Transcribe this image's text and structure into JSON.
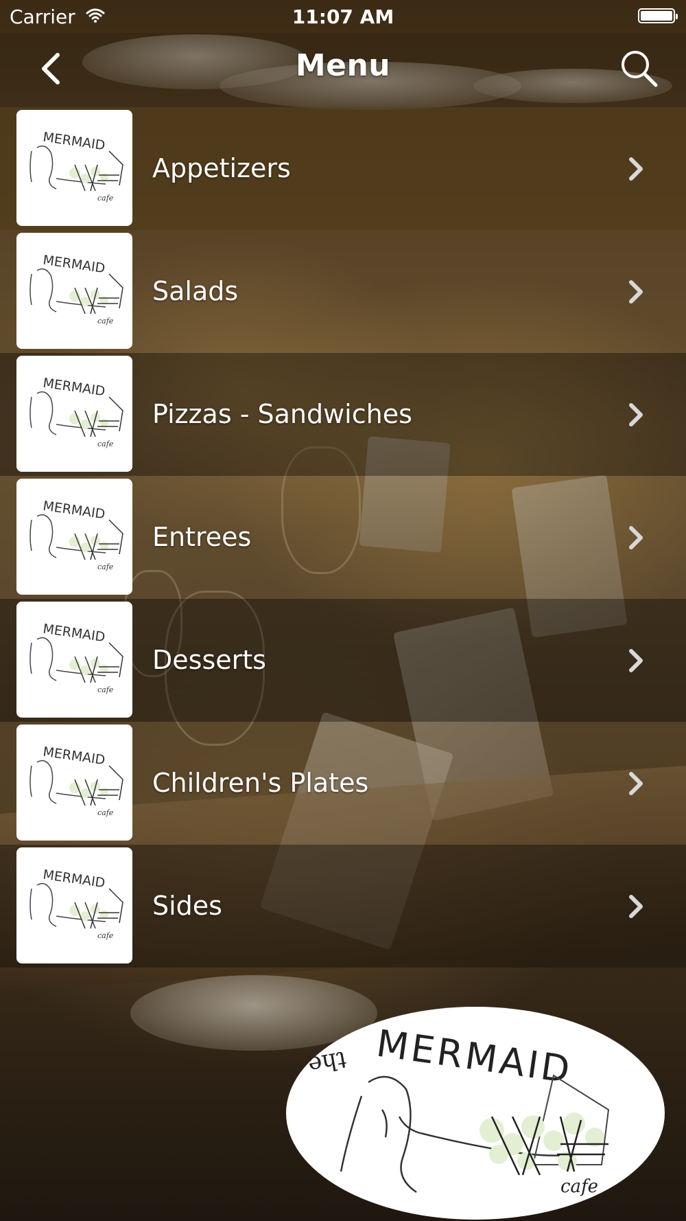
{
  "status_bar": {
    "carrier": "Carrier",
    "time": "11:07 AM",
    "battery_level": 1.0
  },
  "navbar": {
    "title": "Menu",
    "back_icon": "chevron-left-icon",
    "search_icon": "search-icon"
  },
  "menu": {
    "items": [
      {
        "label": "Appetizers"
      },
      {
        "label": "Salads"
      },
      {
        "label": "Pizzas - Sandwiches"
      },
      {
        "label": "Entrees"
      },
      {
        "label": "Desserts"
      },
      {
        "label": "Children's Plates"
      },
      {
        "label": "Sides"
      }
    ],
    "item_icon": "chevron-right-icon"
  },
  "logo": {
    "text_top": "the",
    "text_main": "MERMAID",
    "text_sub": "cafe"
  }
}
